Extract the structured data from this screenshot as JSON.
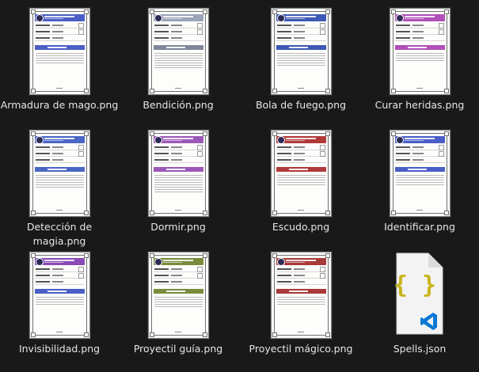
{
  "files": [
    {
      "name": "Armadura de mago.png",
      "kind": "spell-card",
      "accent": "#4a5ec6"
    },
    {
      "name": "Bendición.png",
      "kind": "spell-card",
      "accent": "#8a93a8"
    },
    {
      "name": "Bola de fuego.png",
      "kind": "spell-card",
      "accent": "#3c58b4"
    },
    {
      "name": "Curar heridas.png",
      "kind": "spell-card",
      "accent": "#b050b8"
    },
    {
      "name": "Detección de magia.png",
      "kind": "spell-card",
      "accent": "#4a66c4"
    },
    {
      "name": "Dormir.png",
      "kind": "spell-card",
      "accent": "#9c58b8"
    },
    {
      "name": "Escudo.png",
      "kind": "spell-card",
      "accent": "#b03a3a"
    },
    {
      "name": "Identificar.png",
      "kind": "spell-card",
      "accent": "#4a5ec6"
    },
    {
      "name": "Invisibilidad.png",
      "kind": "spell-card",
      "accent": "#8a4ab8"
    },
    {
      "name": "Proyectil guía.png",
      "kind": "spell-card",
      "accent": "#7a8c3c"
    },
    {
      "name": "Proyectil mágico.png",
      "kind": "spell-card",
      "accent": "#a83a3a"
    },
    {
      "name": "Spells.json",
      "kind": "json-file",
      "accent": "#0a78d4"
    }
  ]
}
